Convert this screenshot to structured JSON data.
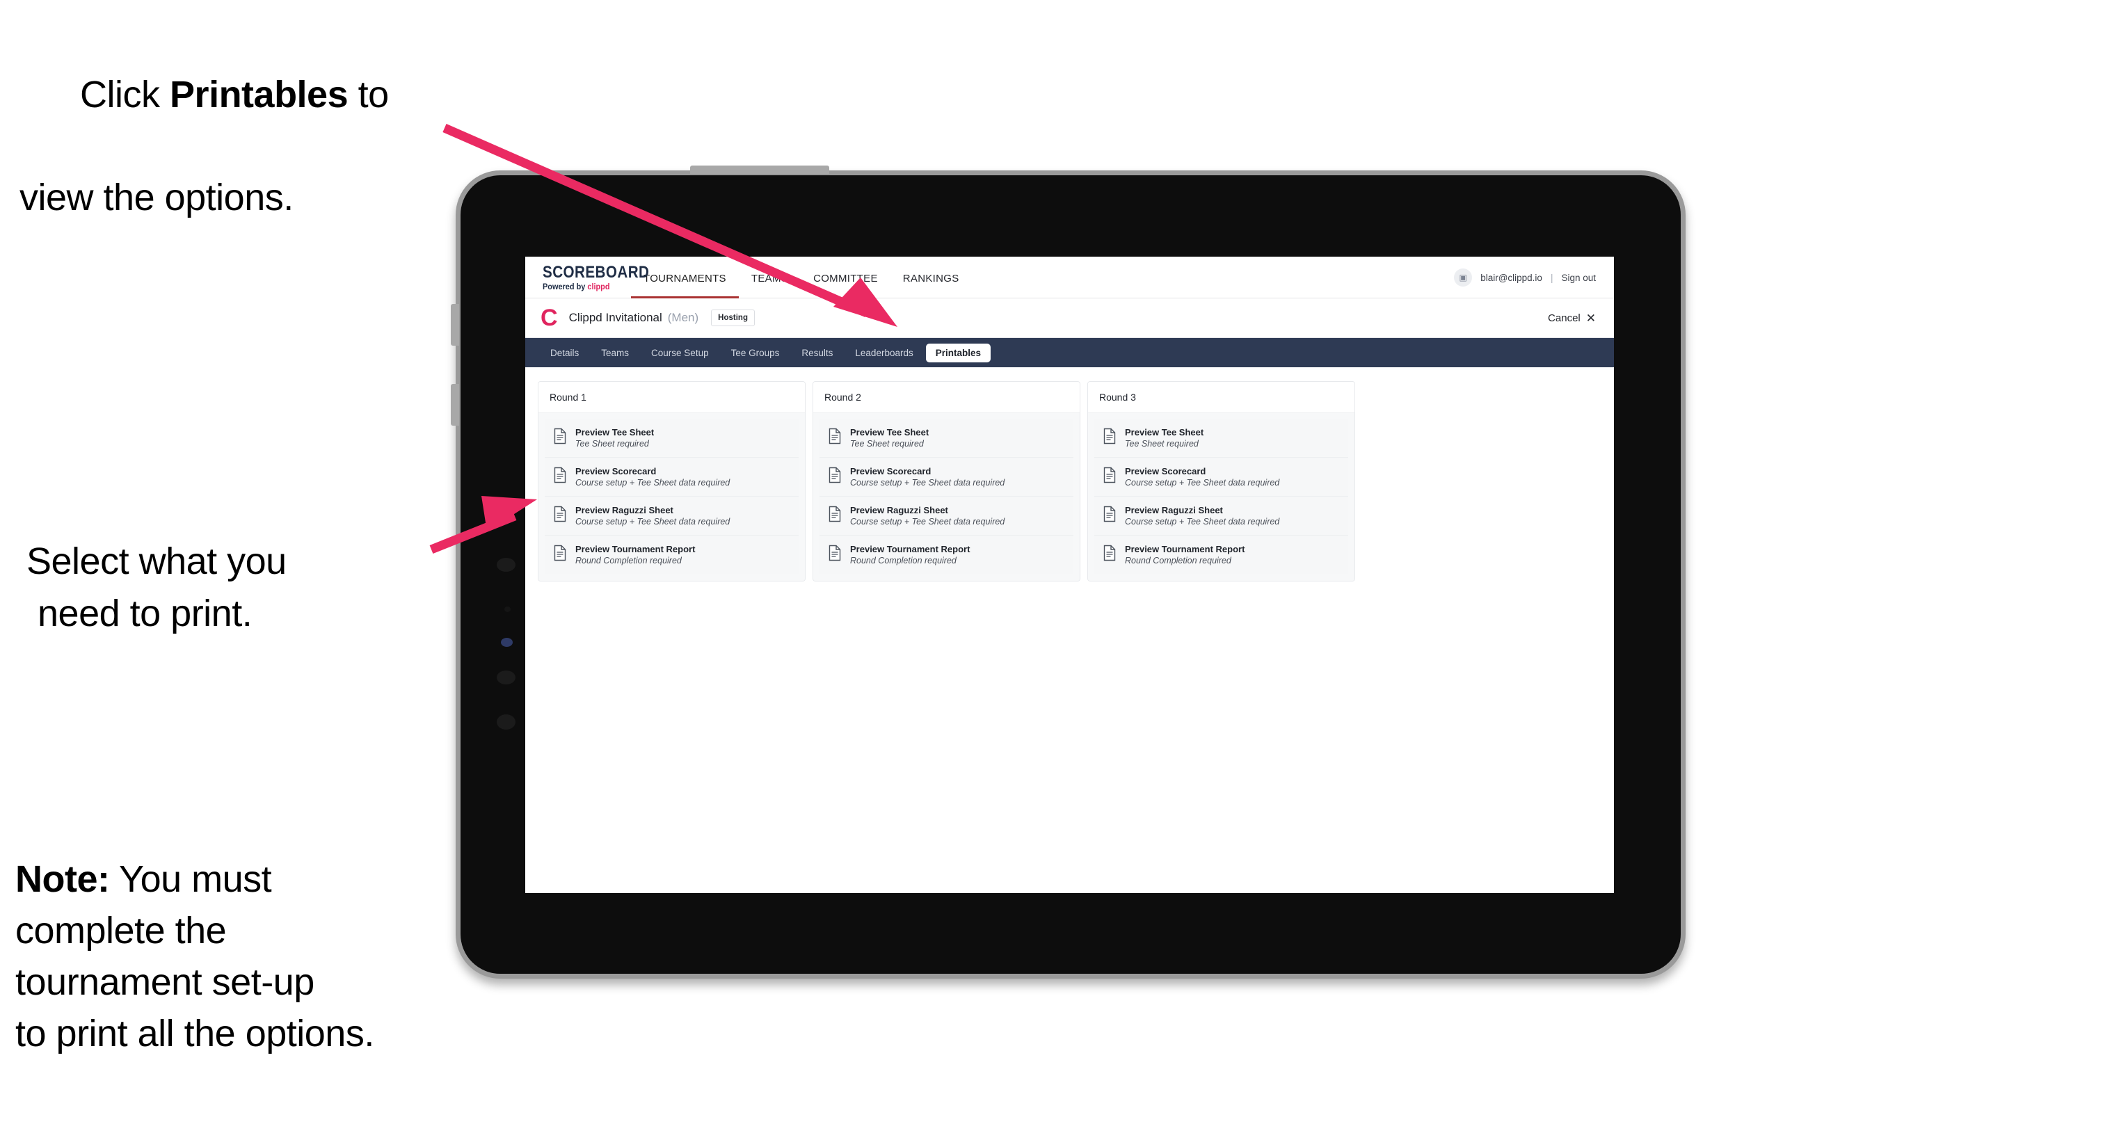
{
  "annotations": {
    "click_printables": {
      "pre": "Click ",
      "bold": "Printables",
      "post": " to",
      "line2": "view the options."
    },
    "select_print": {
      "line1": "Select what you",
      "line2": "need to print."
    },
    "note": {
      "bold": "Note:",
      "line1_rest": " You must",
      "line2": "complete the",
      "line3": "tournament set-up",
      "line4": "to print all the options."
    }
  },
  "app": {
    "brand": {
      "title": "SCOREBOARD",
      "powered_prefix": "Powered by ",
      "powered_accent": "clippd"
    },
    "topnav": [
      {
        "label": "TOURNAMENTS",
        "active": true
      },
      {
        "label": "TEAMS",
        "active": false
      },
      {
        "label": "COMMITTEE",
        "active": false
      },
      {
        "label": "RANKINGS",
        "active": false
      }
    ],
    "account": {
      "avatar_icon": "user-image-icon",
      "email": "blair@clippd.io",
      "separator": "|",
      "sign_out": "Sign out"
    },
    "tournament_bar": {
      "logo_letter": "C",
      "name": "Clippd Invitational",
      "gender": "(Men)",
      "status": "Hosting",
      "cancel_label": "Cancel",
      "cancel_icon": "✕"
    },
    "tabs": [
      {
        "label": "Details",
        "active": false
      },
      {
        "label": "Teams",
        "active": false
      },
      {
        "label": "Course Setup",
        "active": false
      },
      {
        "label": "Tee Groups",
        "active": false
      },
      {
        "label": "Results",
        "active": false
      },
      {
        "label": "Leaderboards",
        "active": false
      },
      {
        "label": "Printables",
        "active": true
      }
    ],
    "rounds": [
      {
        "title": "Round 1",
        "items": [
          {
            "title": "Preview Tee Sheet",
            "subtitle": "Tee Sheet required"
          },
          {
            "title": "Preview Scorecard",
            "subtitle": "Course setup + Tee Sheet data required"
          },
          {
            "title": "Preview Raguzzi Sheet",
            "subtitle": "Course setup + Tee Sheet data required"
          },
          {
            "title": "Preview Tournament Report",
            "subtitle": "Round Completion required"
          }
        ]
      },
      {
        "title": "Round 2",
        "items": [
          {
            "title": "Preview Tee Sheet",
            "subtitle": "Tee Sheet required"
          },
          {
            "title": "Preview Scorecard",
            "subtitle": "Course setup + Tee Sheet data required"
          },
          {
            "title": "Preview Raguzzi Sheet",
            "subtitle": "Course setup + Tee Sheet data required"
          },
          {
            "title": "Preview Tournament Report",
            "subtitle": "Round Completion required"
          }
        ]
      },
      {
        "title": "Round 3",
        "items": [
          {
            "title": "Preview Tee Sheet",
            "subtitle": "Tee Sheet required"
          },
          {
            "title": "Preview Scorecard",
            "subtitle": "Course setup + Tee Sheet data required"
          },
          {
            "title": "Preview Raguzzi Sheet",
            "subtitle": "Course setup + Tee Sheet data required"
          },
          {
            "title": "Preview Tournament Report",
            "subtitle": "Round Completion required"
          }
        ]
      }
    ]
  },
  "colors": {
    "accent_pink": "#ea2a62",
    "navy": "#2e3a54",
    "brand_red": "#e0245e",
    "tab_underline": "#aa3344"
  }
}
